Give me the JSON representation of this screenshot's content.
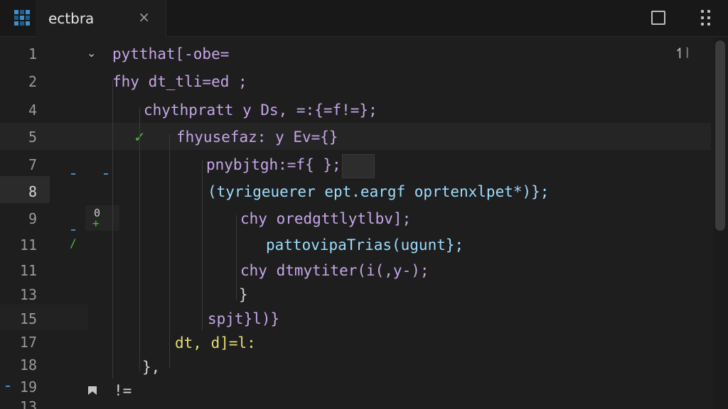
{
  "tab": {
    "title": "ectbra",
    "close": "×"
  },
  "toolbar": {
    "top_right_icon": "↿⦚"
  },
  "gutter": {
    "line_numbers": [
      "1",
      "2",
      "4",
      "5",
      "7",
      "8",
      "9",
      "11",
      "11",
      "13",
      "15",
      "17",
      "18",
      "19",
      "13"
    ],
    "active_line": "8",
    "marker_zero": "0",
    "marker_plus": "+"
  },
  "code": {
    "lines": [
      "pytthat[-obe=",
      "fhy dt_tli=ed ;",
      "chythpratt y Ds, =:{=f!=};",
      "fhyusefaz: y Ev={}",
      "pnybjtgh:=f{ };",
      "(tyrigeuerer ept.eargf oprtenxlpet*)};",
      "chy oredgttlytlbv];",
      "pattovipaTrias(ugunt};",
      "chy dtmytiter(i(,y-);",
      "}",
      "spjt}l)}",
      "dt, d]=l:",
      "},",
      "!="
    ]
  },
  "icons": {
    "fold": "chevron-down-icon",
    "check": "check-icon",
    "bookmark": "bookmark-icon",
    "close": "close-icon",
    "maximize": "maximize-icon",
    "grip": "grip-dots-icon"
  },
  "colors": {
    "keyword": "#c6a5e8",
    "function": "#e6db74",
    "variable": "#9cdcfe",
    "string": "#a6e22e",
    "accent": "#3d8fd1"
  }
}
